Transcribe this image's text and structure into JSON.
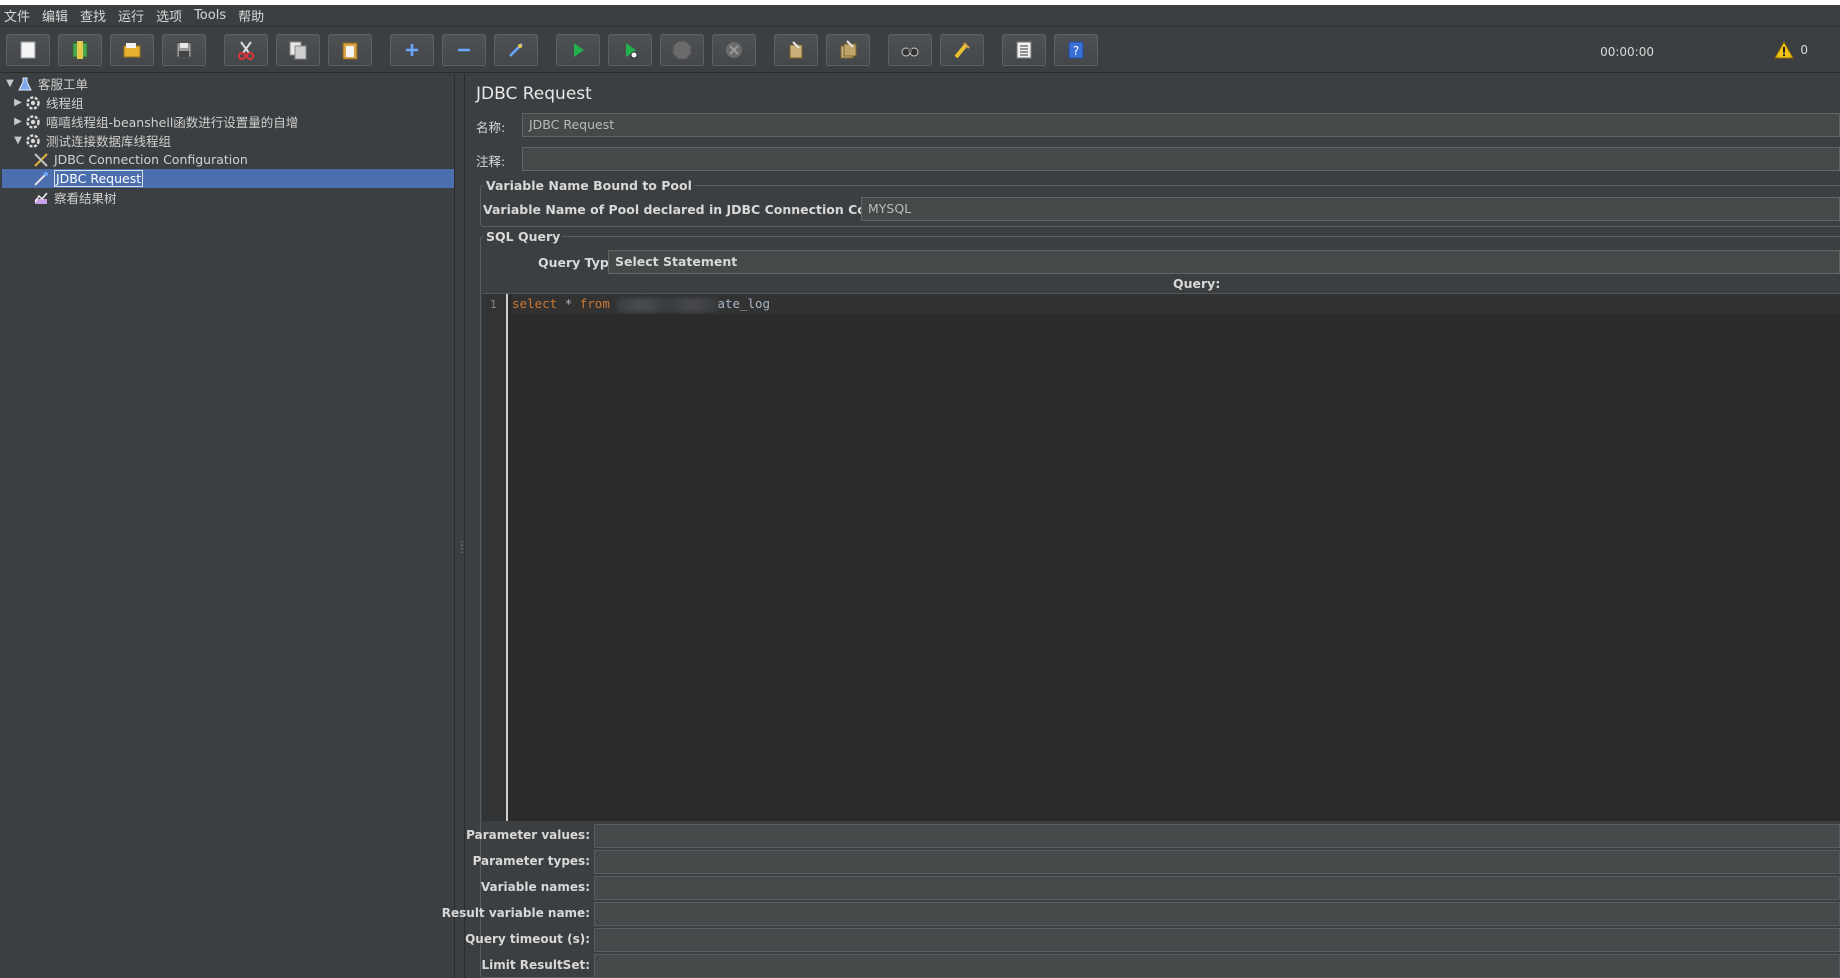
{
  "menubar": {
    "items": [
      "文件",
      "编辑",
      "查找",
      "运行",
      "选项",
      "Tools",
      "帮助"
    ]
  },
  "toolbar": {
    "buttons": [
      "new-icon",
      "templates-icon",
      "open-icon",
      "save-icon",
      "cut-icon",
      "copy-icon",
      "paste-icon",
      "expand-icon",
      "collapse-icon",
      "toggle-icon",
      "start-icon",
      "start-no-pause-icon",
      "stop-icon",
      "shutdown-icon",
      "clear-icon",
      "clear-all-icon",
      "search-icon",
      "reset-search-icon",
      "function-helper-icon",
      "help-icon"
    ],
    "timer": "00:00:00",
    "warning_count": "0"
  },
  "tree": {
    "items": [
      {
        "label": "客服工单",
        "icon": "test-plan-icon",
        "level": 0,
        "expanded": true
      },
      {
        "label": "线程组",
        "icon": "thread-group-icon",
        "level": 1,
        "expanded": false
      },
      {
        "label": "嘻嘻线程组-beanshell函数进行设置量的自增",
        "icon": "thread-group-icon",
        "level": 1,
        "expanded": false
      },
      {
        "label": "测试连接数据库线程组",
        "icon": "thread-group-icon",
        "level": 1,
        "expanded": true
      },
      {
        "label": "JDBC Connection Configuration",
        "icon": "config-icon",
        "level": 2
      },
      {
        "label": "JDBC Request",
        "icon": "sampler-icon",
        "level": 2,
        "selected": true
      },
      {
        "label": "察看结果树",
        "icon": "listener-icon",
        "level": 2
      }
    ]
  },
  "panel": {
    "title": "JDBC Request",
    "name_label": "名称:",
    "name_value": "JDBC Request",
    "comment_label": "注释:",
    "comment_value": "",
    "pool_group_title": "Variable Name Bound to Pool",
    "pool_label": "Variable Name of Pool declared in JDBC Connection Configuration:",
    "pool_value": "MYSQL",
    "sql_group_title": "SQL Query",
    "query_type_label": "Query Type:",
    "query_type_value": "Select Statement",
    "query_header": "Query:",
    "code": {
      "line_number": "1",
      "kw_select": "select",
      "star": "*",
      "kw_from": "from",
      "table_suffix": "ate_log"
    },
    "params": {
      "parameter_values": "Parameter values:",
      "parameter_types": "Parameter types:",
      "variable_names": "Variable names:",
      "result_variable_name": "Result variable name:",
      "query_timeout": "Query timeout (s):",
      "limit_resultset": "Limit ResultSet:"
    }
  },
  "colors": {
    "background": "#3c3f41",
    "selection": "#4b6eaf",
    "keyword": "#cc7832",
    "editor_bg": "#2b2b2b"
  }
}
